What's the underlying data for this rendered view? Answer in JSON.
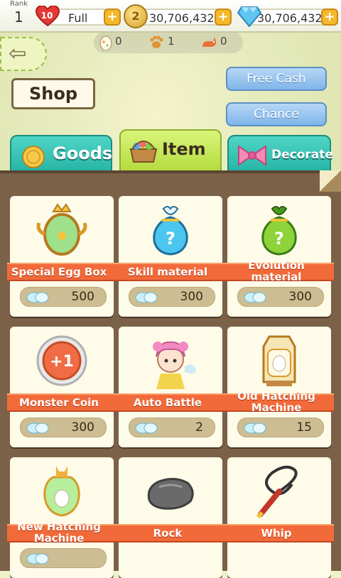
{
  "header": {
    "rank_label": "Rank",
    "rank_value": "1",
    "hearts_badge": "10",
    "hearts_status": "Full",
    "coins": "30,706,432",
    "coin_symbol": "2",
    "gems": "30,706,432"
  },
  "counters": {
    "eggs": "0",
    "paws": "1",
    "pets": "0"
  },
  "page_title": "Shop",
  "buttons": {
    "free_cash": "Free Cash",
    "chance": "Chance"
  },
  "tabs": [
    {
      "label": "Goods",
      "icon": "coin-icon",
      "active": false
    },
    {
      "label": "Item",
      "icon": "basket-icon",
      "active": true
    },
    {
      "label": "Decorate",
      "icon": "bow-icon",
      "active": false
    }
  ],
  "items": [
    {
      "name": "Special Egg Box",
      "price": "500",
      "icon": "egg-box-icon"
    },
    {
      "name": "Skill material",
      "price": "300",
      "icon": "blue-pouch-icon"
    },
    {
      "name": "Evolution material",
      "price": "300",
      "icon": "green-pouch-icon"
    },
    {
      "name": "Monster Coin",
      "price": "300",
      "icon": "monster-coin-icon"
    },
    {
      "name": "Auto Battle",
      "price": "2",
      "icon": "fairy-icon"
    },
    {
      "name": "Old Hatching Machine",
      "price": "15",
      "icon": "hatching-machine-icon"
    },
    {
      "name": "New Hatching Machine",
      "price": "",
      "icon": "new-hatching-machine-icon"
    },
    {
      "name": "Rock",
      "price": "",
      "icon": "rock-icon"
    },
    {
      "name": "Whip",
      "price": "",
      "icon": "whip-icon"
    }
  ],
  "colors": {
    "ribbon": "#f26a3a",
    "tab_active": "#b5dc3f",
    "tab_inactive": "#24b3a4",
    "side_button": "#7fb5ea"
  }
}
